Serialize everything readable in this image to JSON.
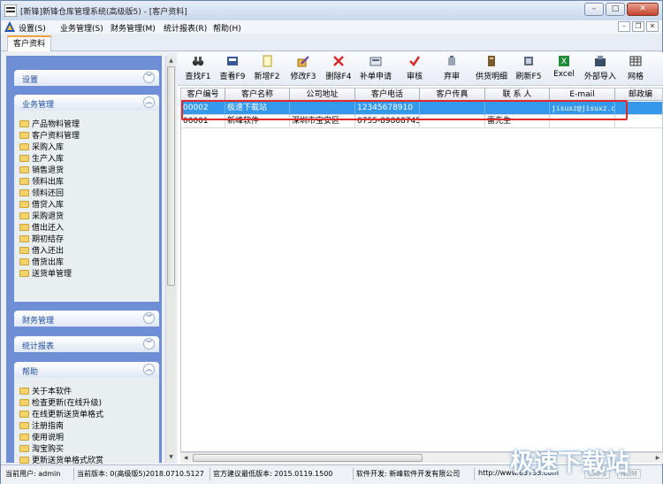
{
  "window": {
    "title": "[新锋]新锋仓库管理系统(高级版5) - [客户资料]"
  },
  "menu": {
    "items": [
      "设置(S)",
      "业务管理(S)",
      "财务管理(M)",
      "统计报表(R)",
      "帮助(H)"
    ]
  },
  "tabs": [
    "客户资料"
  ],
  "sidebar": {
    "groups": [
      {
        "title": "设置",
        "expanded": false
      },
      {
        "title": "业务管理",
        "expanded": true,
        "items": [
          "产品物料管理",
          "客户资料管理",
          "采购入库",
          "生产入库",
          "销售退货",
          "领料出库",
          "领料还回",
          "借贷入库",
          "采购退货",
          "借出还入",
          "期初结存",
          "借入还出",
          "借货出库",
          "送货单管理"
        ]
      },
      {
        "title": "财务管理",
        "expanded": false
      },
      {
        "title": "统计报表",
        "expanded": false
      },
      {
        "title": "帮助",
        "expanded": true,
        "items": [
          "关于本软件",
          "检查更新(在线升级)",
          "在线更新送货单格式",
          "注册指南",
          "使用说明",
          "淘宝购买",
          "更新送货单格式欣赏"
        ]
      }
    ]
  },
  "toolbar": {
    "buttons": [
      {
        "label": "查找F1",
        "icon": "binoculars-icon"
      },
      {
        "label": "查看F9",
        "icon": "view-icon"
      },
      {
        "label": "新增F2",
        "icon": "new-icon"
      },
      {
        "label": "修改F3",
        "icon": "edit-icon"
      },
      {
        "label": "删除F4",
        "icon": "delete-icon"
      },
      {
        "label": "补单申请",
        "icon": "apply-icon"
      },
      {
        "label": "审核",
        "icon": "check-icon"
      },
      {
        "label": "弃审",
        "icon": "unaudit-icon"
      },
      {
        "label": "供货明细",
        "icon": "detail-icon"
      },
      {
        "label": "刷新F5",
        "icon": "refresh-icon"
      },
      {
        "label": "Excel",
        "icon": "excel-icon"
      },
      {
        "label": "外部导入",
        "icon": "import-icon"
      },
      {
        "label": "网格",
        "icon": "grid-icon"
      }
    ]
  },
  "grid": {
    "columns": [
      "客户编号",
      "客户名称",
      "公司地址",
      "客户电话",
      "客户传真",
      "联 系 人",
      "E-mail",
      "邮政编"
    ],
    "rows": [
      [
        "00002",
        "极速下载站",
        "",
        "12345678910",
        "",
        "",
        "jisuxz@jisuxz.c",
        ""
      ],
      [
        "00001",
        "新峰软件",
        "深圳市宝安区",
        "0755-89808745",
        "",
        "雷先生",
        "",
        ""
      ]
    ],
    "selected_row": 0
  },
  "statusbar": {
    "user": "当前用户: admin",
    "version": "当前版本: 0(高级版5)2018.0710.5127",
    "min_version": "官方建议最低版本: 2015.0119.1500",
    "developer": "软件开发: 新峰软件开发有限公司",
    "url": "http://www.63733.com",
    "caps": "CAPS",
    "num": "NUM"
  },
  "watermark": "极速下载站",
  "colors": {
    "selection": "#3499ea",
    "sidebar": "#6e8fd6",
    "highlight_box": "#e02a2a"
  }
}
